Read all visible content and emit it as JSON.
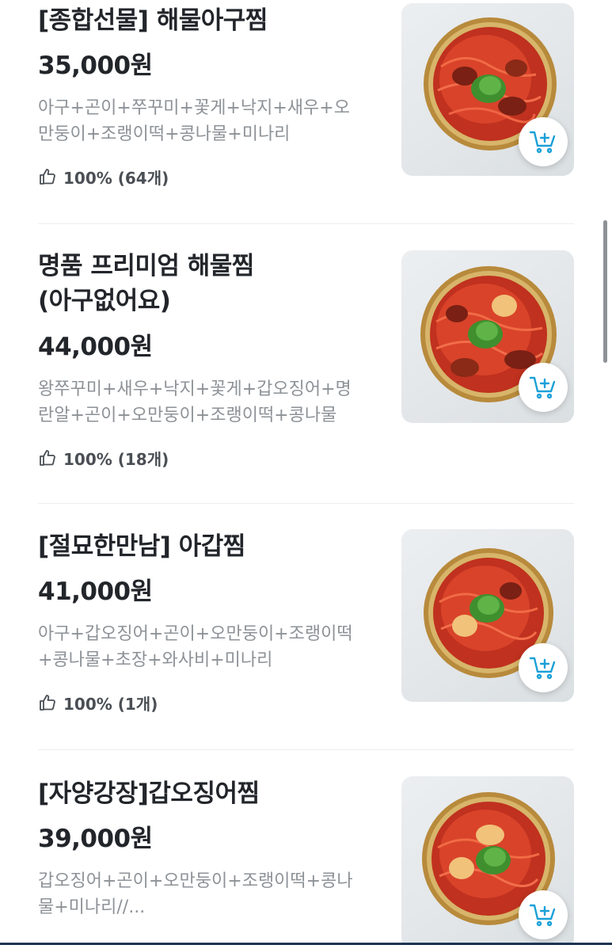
{
  "menu": {
    "items": [
      {
        "name": "[종합선물] 해물아구찜",
        "price": "35,000원",
        "description": "아구+곤이+쭈꾸미+꽃게+낙지+새우+오만둥이+조랭이떡+콩나물+미나리",
        "rating": "100% (64개)"
      },
      {
        "name": "명품 프리미엄 해물찜\n(아구없어요)",
        "price": "44,000원",
        "description": "왕쭈꾸미+새우+낙지+꽃게+갑오징어+명란알+곤이+오만둥이+조랭이떡+콩나물",
        "rating": "100% (18개)"
      },
      {
        "name": "[절묘한만남] 아갑찜",
        "price": "41,000원",
        "description": "아구+갑오징어+곤이+오만둥이+조랭이떡+콩나물+초장+와사비+미나리",
        "rating": "100% (1개)"
      },
      {
        "name": "[자양강장]갑오징어찜",
        "price": "39,000원",
        "description": "갑오징어+곤이+오만둥이+조랭이떡+콩나물+미나리//...",
        "rating": ""
      }
    ]
  },
  "icons": {
    "like": "thumbs-up-icon",
    "cart": "cart-plus-icon"
  },
  "colors": {
    "accent": "#1aa0d8",
    "text": "#22252a",
    "muted": "#8d9297"
  }
}
